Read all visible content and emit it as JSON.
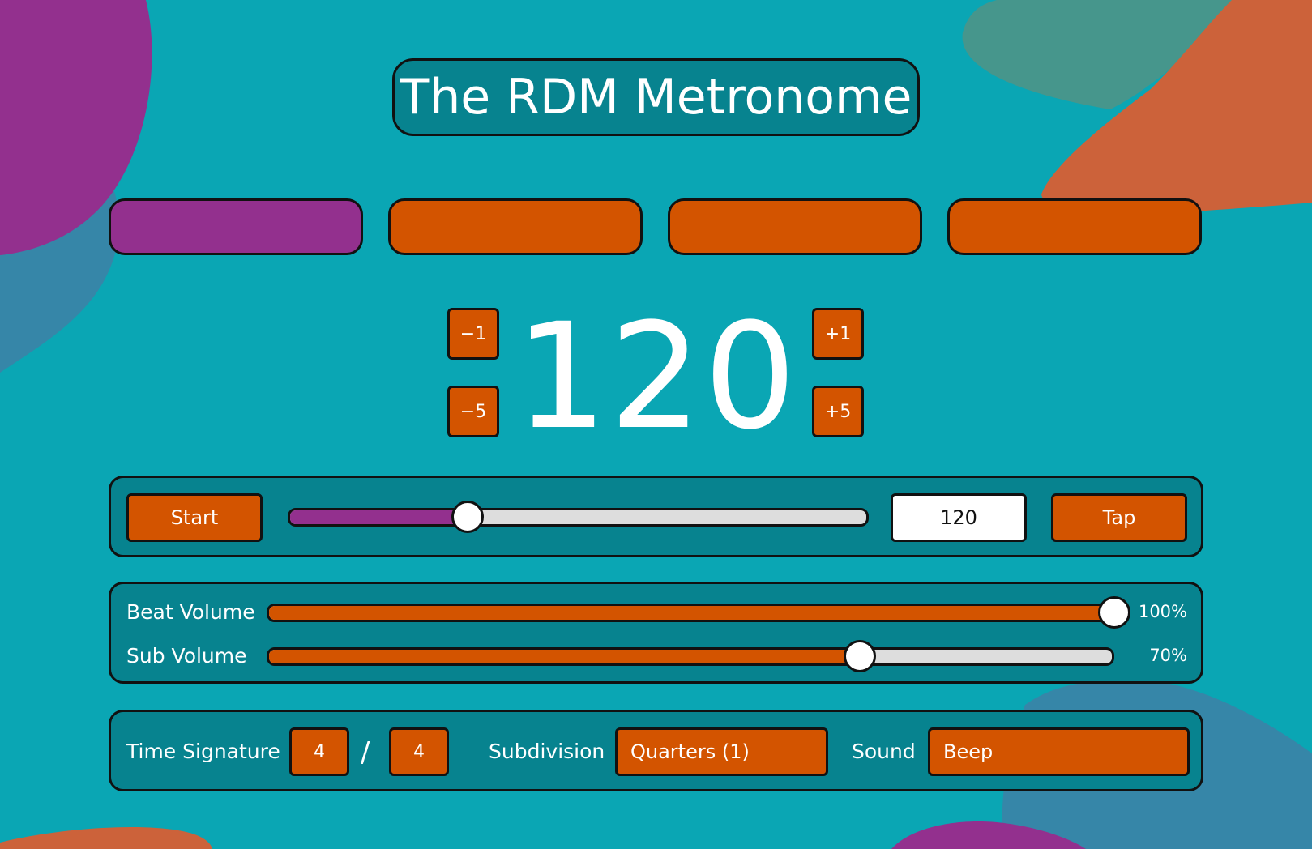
{
  "app": {
    "title": "The RDM Metronome"
  },
  "beats": [
    {
      "active": true
    },
    {
      "active": false
    },
    {
      "active": false
    },
    {
      "active": false
    }
  ],
  "tempo": {
    "display": "120",
    "minus1": "−1",
    "minus5": "−5",
    "plus1": "+1",
    "plus5": "+5"
  },
  "controls": {
    "start_label": "Start",
    "tap_label": "Tap",
    "bpm_input": "120",
    "tempo_slider_fraction": 0.31
  },
  "volume": {
    "beat_label": "Beat Volume",
    "beat_percent": "100%",
    "beat_fraction": 1.0,
    "sub_label": "Sub Volume",
    "sub_percent": "70%",
    "sub_fraction": 0.7
  },
  "settings": {
    "time_signature_label": "Time Signature",
    "ts_numerator": "4",
    "ts_separator": "/",
    "ts_denominator": "4",
    "subdivision_label": "Subdivision",
    "subdivision_value": "Quarters (1)",
    "sound_label": "Sound",
    "sound_value": "Beep"
  },
  "colors": {
    "background": "#0aa6b4",
    "panel": "#07838f",
    "accent_orange": "#d35400",
    "accent_purple": "#93308e",
    "blob_green": "#46968c",
    "blob_blue": "#3686a8",
    "blob_orange": "#cc623a"
  }
}
